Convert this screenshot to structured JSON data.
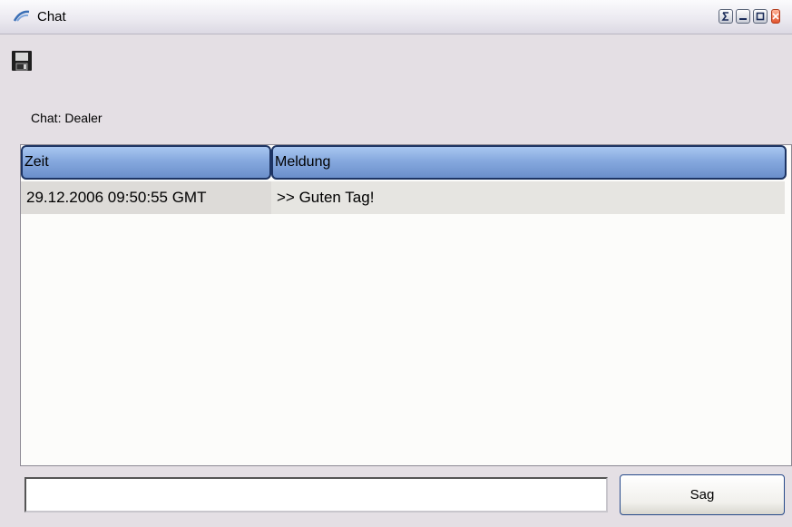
{
  "window": {
    "title": "Chat"
  },
  "toolbar": {
    "save_icon": "save-disk-icon"
  },
  "chat": {
    "label": "Chat: Dealer"
  },
  "table": {
    "columns": [
      "Zeit",
      "Meldung"
    ],
    "rows": [
      {
        "zeit": "29.12.2006 09:50:55 GMT",
        "meldung": ">> Guten Tag!"
      }
    ]
  },
  "input": {
    "value": "",
    "placeholder": ""
  },
  "send_button": {
    "label": "Sag"
  },
  "colors": {
    "header_blue": "#86a9de",
    "window_bg": "#e4dfe4"
  }
}
